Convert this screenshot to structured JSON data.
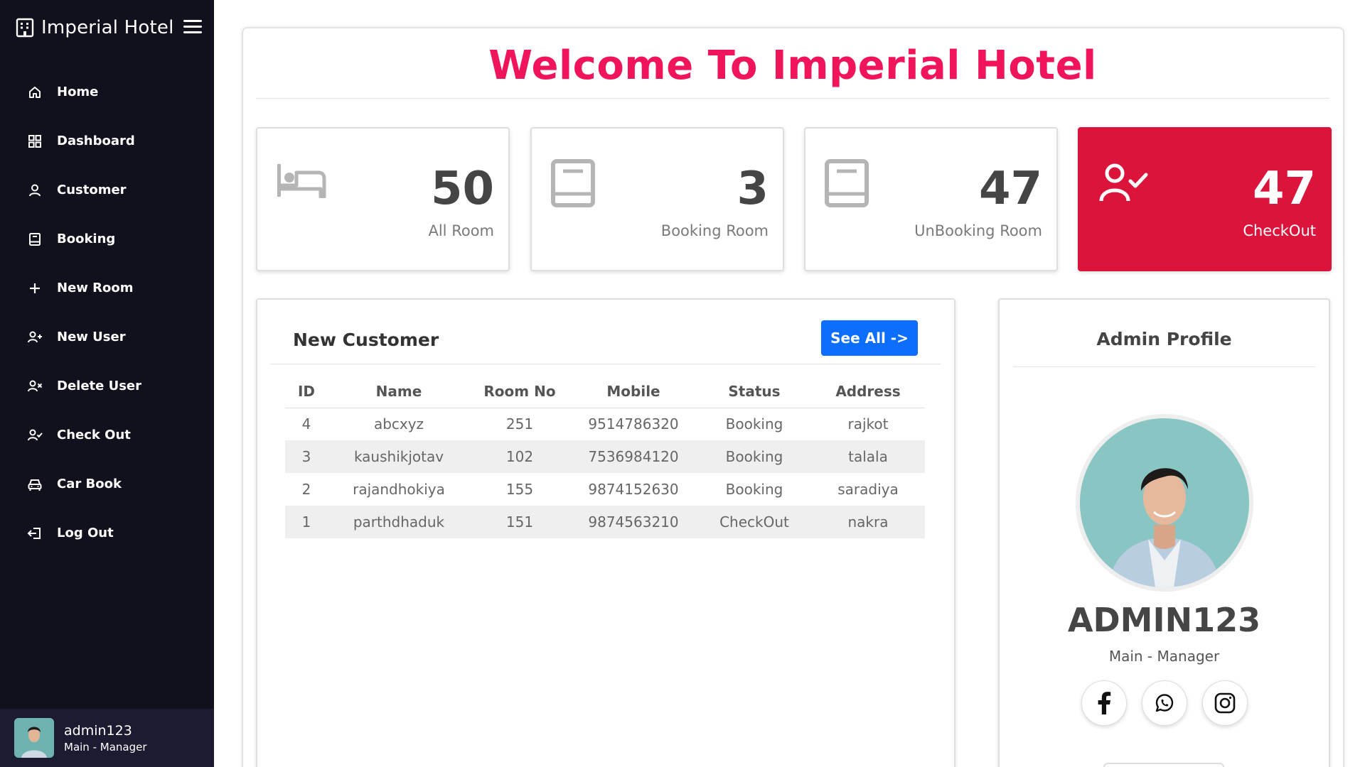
{
  "sidebar": {
    "brand": "Imperial Hotel",
    "items": [
      {
        "label": "Home",
        "icon": "home-icon"
      },
      {
        "label": "Dashboard",
        "icon": "grid-icon"
      },
      {
        "label": "Customer",
        "icon": "user-icon"
      },
      {
        "label": "Booking",
        "icon": "book-icon"
      },
      {
        "label": "New Room",
        "icon": "plus-icon"
      },
      {
        "label": "New User",
        "icon": "user-add-icon"
      },
      {
        "label": "Delete User",
        "icon": "user-x-icon"
      },
      {
        "label": "Check Out",
        "icon": "user-check-icon"
      },
      {
        "label": "Car Book",
        "icon": "car-icon"
      },
      {
        "label": "Log Out",
        "icon": "logout-icon"
      }
    ],
    "profile": {
      "name": "admin123",
      "role": "Main - Manager"
    }
  },
  "welcome": "Welcome To Imperial Hotel",
  "stats": [
    {
      "value": "50",
      "label": "All Room",
      "icon": "bed-icon"
    },
    {
      "value": "3",
      "label": "Booking Room",
      "icon": "book-icon"
    },
    {
      "value": "47",
      "label": "UnBooking Room",
      "icon": "book-icon"
    },
    {
      "value": "47",
      "label": "CheckOut",
      "icon": "user-check-icon"
    }
  ],
  "customers": {
    "title": "New Customer",
    "see_all": "See All ->",
    "columns": [
      "ID",
      "Name",
      "Room No",
      "Mobile",
      "Status",
      "Address"
    ],
    "rows": [
      [
        "4",
        "abcxyz",
        "251",
        "9514786320",
        "Booking",
        "rajkot"
      ],
      [
        "3",
        "kaushikjotav",
        "102",
        "7536984120",
        "Booking",
        "talala"
      ],
      [
        "2",
        "rajandhokiya",
        "155",
        "9874152630",
        "Booking",
        "saradiya"
      ],
      [
        "1",
        "parthdhaduk",
        "151",
        "9874563210",
        "CheckOut",
        "nakra"
      ]
    ]
  },
  "admin": {
    "title": "Admin Profile",
    "name": "ADMIN123",
    "role": "Main - Manager",
    "social": [
      "facebook-icon",
      "whatsapp-icon",
      "instagram-icon"
    ]
  },
  "colors": {
    "sidebar": "#11101d",
    "welcome": "#f0145a",
    "checkout_card": "#dc143c",
    "primary_button": "#0d6efd",
    "status_booking": "#118000",
    "status_checkout": "#1a1ad6"
  }
}
